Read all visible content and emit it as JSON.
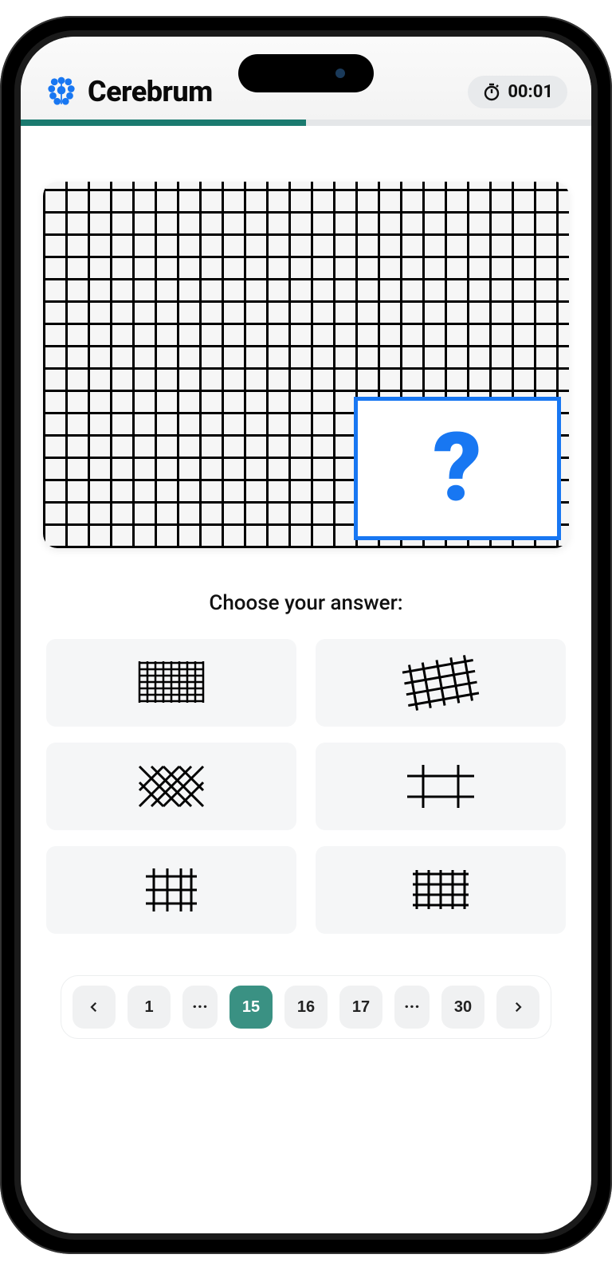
{
  "header": {
    "brand_name": "Cerebrum",
    "timer_value": "00:01"
  },
  "progress": {
    "percent": 50
  },
  "puzzle": {
    "missing_symbol": "?"
  },
  "prompt": "Choose your answer:",
  "answers": [
    {
      "name": "dense-grid"
    },
    {
      "name": "skewed-grid"
    },
    {
      "name": "diamond-lattice"
    },
    {
      "name": "cross-frame"
    },
    {
      "name": "sparse-grid-tall"
    },
    {
      "name": "small-regular-grid"
    }
  ],
  "pager": {
    "first": "1",
    "ellipsis": "···",
    "current": "15",
    "next1": "16",
    "next2": "17",
    "last": "30"
  }
}
